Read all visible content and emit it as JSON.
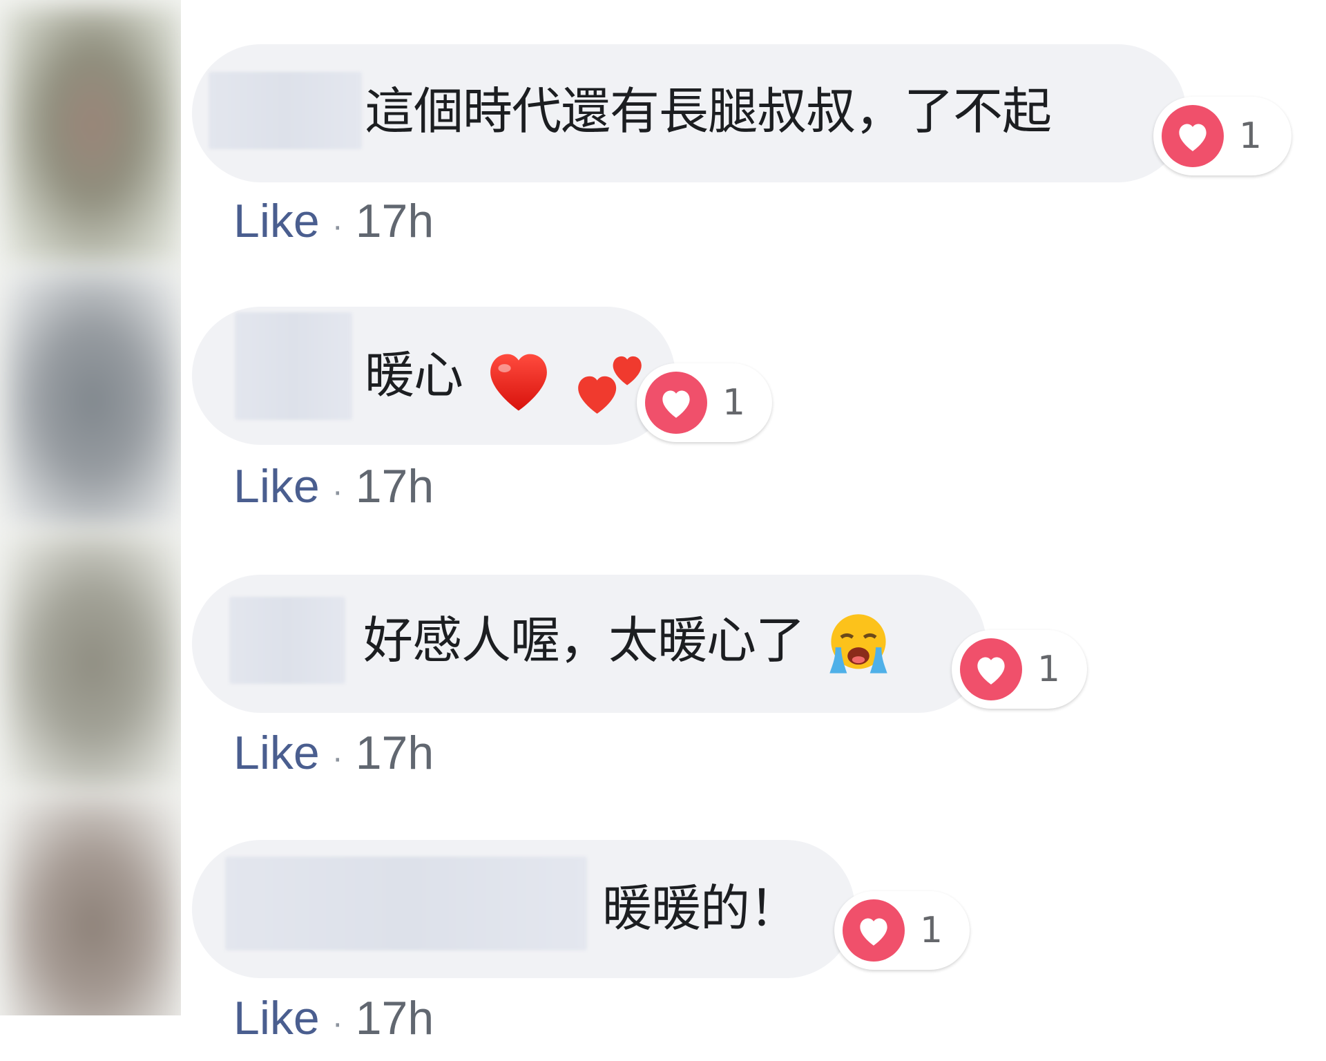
{
  "comments": [
    {
      "text": "這個時代還有長腿叔叔，了不起",
      "emoji_suffix": [],
      "reaction": {
        "icon": "heart-icon",
        "count": "1"
      },
      "like_label": "Like",
      "separator": "·",
      "time": "17h"
    },
    {
      "text": "暖心",
      "emoji_suffix": [
        "red-heart-emoji",
        "two-hearts-emoji"
      ],
      "reaction": {
        "icon": "heart-icon",
        "count": "1"
      },
      "like_label": "Like",
      "separator": "·",
      "time": "17h"
    },
    {
      "text": "好感人喔，太暖心了",
      "emoji_suffix": [
        "loudly-crying-face-emoji"
      ],
      "reaction": {
        "icon": "heart-icon",
        "count": "1"
      },
      "like_label": "Like",
      "separator": "·",
      "time": "17h"
    },
    {
      "text": "暖暖的！",
      "emoji_suffix": [],
      "reaction": {
        "icon": "heart-icon",
        "count": "1"
      },
      "like_label": "Like",
      "separator": "·",
      "time": "17h"
    }
  ],
  "colors": {
    "bubble_bg": "#f1f2f5",
    "like_link": "#4a5e8f",
    "reaction_heart": "#f0506b",
    "meta_gray": "#616770"
  }
}
